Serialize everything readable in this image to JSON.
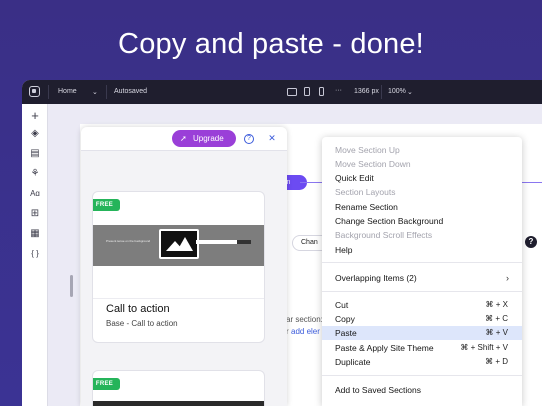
{
  "headline": "Copy and paste - done!",
  "topbar": {
    "page": "Home",
    "page_caret": "⌄",
    "status": "Autosaved",
    "dots": "···",
    "width": "1366 px",
    "zoom": "100%",
    "zoom_caret": "⌄"
  },
  "rail": {
    "add": "+",
    "sections": "◈",
    "pages": "▤",
    "design": "⚘",
    "text": "Aɑ",
    "apps": "⊞",
    "table": "▦",
    "code": "{ }"
  },
  "canvas": {
    "section_pill": "ion",
    "change_btn": "Chan",
    "help": "?",
    "frag1": "ar section:",
    "frag2": "r",
    "frag2_link": "add eler"
  },
  "panel": {
    "upgrade_label": "Upgrade",
    "rocket": "➚",
    "help": "?",
    "close": "✕",
    "cards": [
      {
        "badge": "FREE",
        "thumb_caption": "Present tense on the background",
        "title": "Call to action",
        "subtitle": "Base - Call to action"
      },
      {
        "badge": "FREE"
      }
    ]
  },
  "menu": {
    "items": [
      {
        "label": "Move Section Up",
        "disabled": true
      },
      {
        "label": "Move Section Down",
        "disabled": true
      },
      {
        "label": "Quick Edit",
        "disabled": false
      },
      {
        "label": "Section Layouts",
        "disabled": true
      },
      {
        "label": "Rename Section",
        "disabled": false
      },
      {
        "label": "Change Section Background",
        "disabled": false
      },
      {
        "label": "Background Scroll Effects",
        "disabled": true
      },
      {
        "label": "Help",
        "disabled": false
      },
      {
        "label": "Overlapping Items (2)",
        "disabled": false,
        "chevron": "›"
      },
      {
        "label": "Cut",
        "shortcut": "⌘ + X"
      },
      {
        "label": "Copy",
        "shortcut": "⌘ + C"
      },
      {
        "label": "Paste",
        "shortcut": "⌘ + V",
        "selected": true
      },
      {
        "label": "Paste & Apply Site Theme",
        "shortcut": "⌘ + Shift + V"
      },
      {
        "label": "Duplicate",
        "shortcut": "⌘ + D"
      },
      {
        "label": "Add to Saved Sections"
      }
    ]
  },
  "colors": {
    "background": "#3a2f86",
    "accent_purple": "#6c4bf2",
    "upgrade": "#9a3fd8",
    "free_badge": "#25b45a",
    "menu_selected": "#dde6fb"
  }
}
